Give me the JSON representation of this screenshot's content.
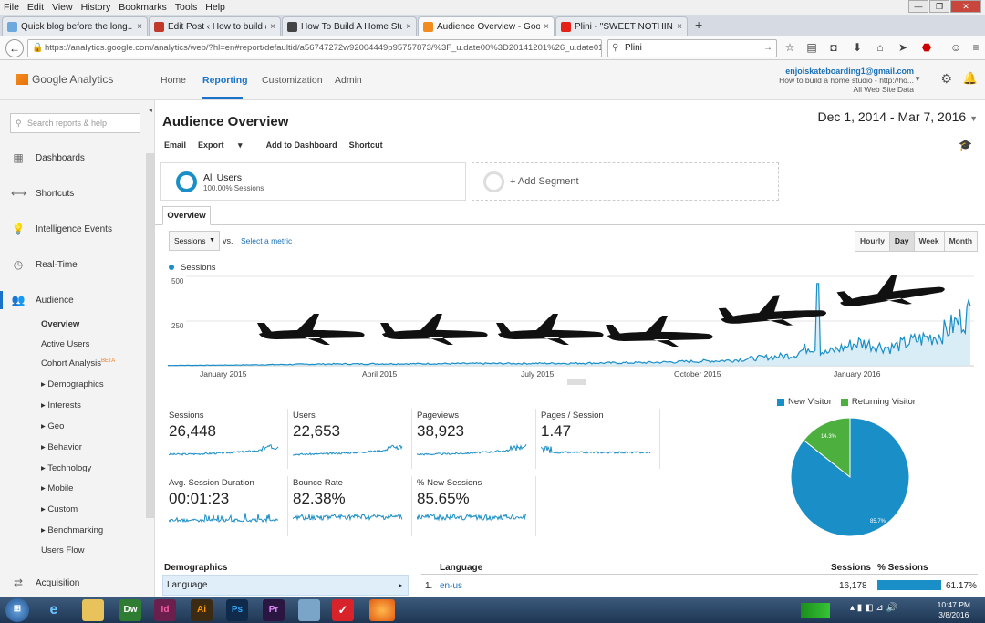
{
  "browser": {
    "menu": [
      "File",
      "Edit",
      "View",
      "History",
      "Bookmarks",
      "Tools",
      "Help"
    ],
    "tabs": [
      {
        "title": "Quick blog before the long...",
        "icon_color": "#6fa8dc"
      },
      {
        "title": "Edit Post ‹ How to build a ...",
        "icon_color": "#c0392b"
      },
      {
        "title": "How To Build A Home Stu...",
        "icon_color": "#444444"
      },
      {
        "title": "Audience Overview - Goog...",
        "icon_color": "#f28c1e"
      },
      {
        "title": "Plini - \"SWEET NOTHIN...",
        "icon_color": "#e62117"
      }
    ],
    "tab_close": "×",
    "new_tab": "+",
    "url": "https://analytics.google.com/analytics/web/?hl=en#report/defaultid/a56747272w92004449p95757873/%3F_u.date00%3D20141201%26_u.date01%3D20",
    "search_value": "Plini",
    "win_controls": [
      "—",
      "❐",
      "✕"
    ]
  },
  "ga": {
    "logo_text": "Google Analytics",
    "nav": [
      "Home",
      "Reporting",
      "Customization",
      "Admin"
    ],
    "account_email": "enjoiskateboarding1@gmail.com",
    "account_property": "How to build a home studio - http://ho...",
    "account_view": "All Web Site Data"
  },
  "sidebar": {
    "search_placeholder": "Search reports & help",
    "items": [
      {
        "label": "Dashboards",
        "icon": "grid-icon"
      },
      {
        "label": "Shortcuts",
        "icon": "shortcut-arrows-icon"
      },
      {
        "label": "Intelligence Events",
        "icon": "lightbulb-icon"
      },
      {
        "label": "Real-Time",
        "icon": "clock-icon"
      },
      {
        "label": "Audience",
        "icon": "people-icon"
      },
      {
        "label": "Acquisition",
        "icon": "acquisition-arrows-icon"
      }
    ],
    "audience_sub": [
      "Overview",
      "Active Users",
      "Cohort Analysis",
      "Demographics",
      "Interests",
      "Geo",
      "Behavior",
      "Technology",
      "Mobile",
      "Custom",
      "Benchmarking",
      "Users Flow"
    ],
    "beta": "BETA"
  },
  "report": {
    "title": "Audience Overview",
    "date_range": "Dec 1, 2014 - Mar 7, 2016",
    "toolbar": [
      "Email",
      "Export",
      "Add to Dashboard",
      "Shortcut"
    ],
    "segment_name": "All Users",
    "segment_pct": "100.00% Sessions",
    "add_segment": "+ Add Segment",
    "tab": "Overview",
    "metric_select": "Sessions",
    "vs": "vs.",
    "select_metric": "Select a metric",
    "granularity": [
      "Hourly",
      "Day",
      "Week",
      "Month"
    ],
    "granularity_selected": "Day",
    "legend": "Sessions",
    "y_ticks": [
      "500",
      "250"
    ],
    "x_ticks": [
      "January 2015",
      "April 2015",
      "July 2015",
      "October 2015",
      "January 2016"
    ]
  },
  "chart_data": {
    "type": "area",
    "title": "",
    "series": [
      {
        "name": "Sessions",
        "color": "#1a8ec6"
      }
    ],
    "x_range": [
      "2014-12-01",
      "2016-03-07"
    ],
    "ylim": [
      0,
      500
    ],
    "trend_points": [
      [
        0,
        2
      ],
      [
        0.08,
        4
      ],
      [
        0.2,
        10
      ],
      [
        0.35,
        12
      ],
      [
        0.5,
        14
      ],
      [
        0.6,
        18
      ],
      [
        0.7,
        30
      ],
      [
        0.78,
        60
      ],
      [
        0.8,
        110
      ],
      [
        0.82,
        70
      ],
      [
        0.86,
        130
      ],
      [
        0.9,
        100
      ],
      [
        0.93,
        140
      ],
      [
        0.96,
        170
      ],
      [
        0.98,
        230
      ],
      [
        1,
        300
      ]
    ],
    "peak_annotation": {
      "x": 0.81,
      "y": 460
    }
  },
  "metrics": [
    {
      "label": "Sessions",
      "value": "26,448"
    },
    {
      "label": "Users",
      "value": "22,653"
    },
    {
      "label": "Pageviews",
      "value": "38,923"
    },
    {
      "label": "Pages / Session",
      "value": "1.47"
    },
    {
      "label": "Avg. Session Duration",
      "value": "00:01:23"
    },
    {
      "label": "Bounce Rate",
      "value": "82.38%"
    },
    {
      "label": "% New Sessions",
      "value": "85.65%"
    }
  ],
  "pie": {
    "legend_new": "New Visitor",
    "legend_returning": "Returning Visitor",
    "new_label": "85.7%",
    "returning_label": "14.3%",
    "new_value": 85.7,
    "returning_value": 14.3,
    "new_color": "#1a8ec6",
    "returning_color": "#4caf3e"
  },
  "table": {
    "demographics_head": "Demographics",
    "demographics_row": "Language",
    "language_head": "Language",
    "sessions_head": "Sessions",
    "pct_head": "% Sessions",
    "row_index": "1.",
    "row_lang": "en-us",
    "row_sessions": "16,178",
    "row_pct": "61.17%",
    "row_pct_value": 61.17
  },
  "taskbar": {
    "apps": [
      "Dw",
      "Id",
      "Ai",
      "Ps",
      "Pr"
    ],
    "time": "10:47 PM",
    "date": "3/8/2016"
  }
}
